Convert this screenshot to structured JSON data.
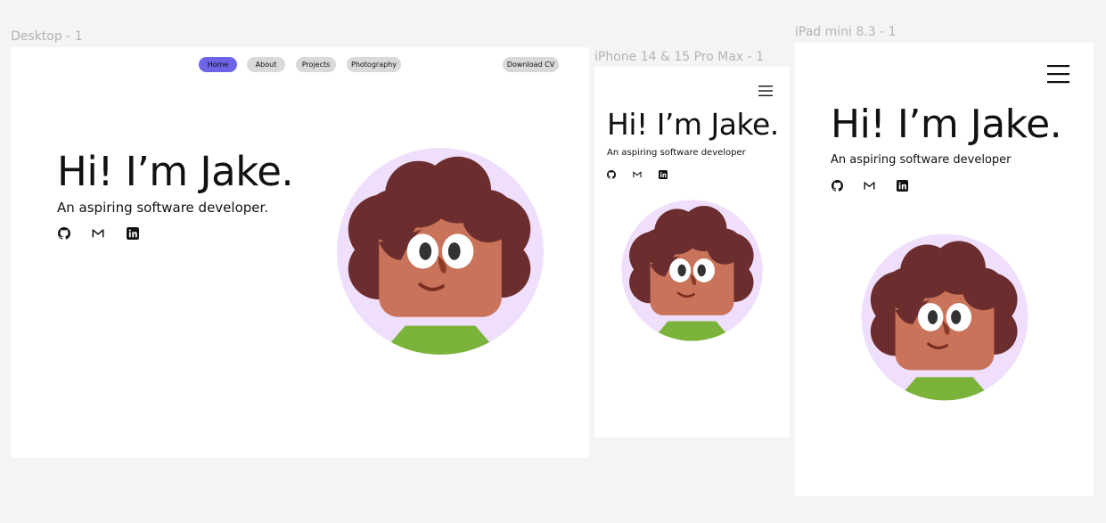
{
  "frames": {
    "desktop": {
      "label": "Desktop - 1",
      "nav": {
        "home": "Home",
        "about": "About",
        "projects": "Projects",
        "photography": "Photography",
        "download_cv": "Download CV"
      },
      "title": "Hi! I’m Jake.",
      "subtitle": "An aspiring software developer."
    },
    "iphone": {
      "label": "iPhone 14 & 15 Pro Max - 1",
      "title": "Hi! I’m Jake.",
      "subtitle": "An aspiring software developer"
    },
    "ipad": {
      "label": "iPad mini 8.3 - 1",
      "title": "Hi! I’m Jake.",
      "subtitle": "An aspiring software developer"
    }
  },
  "colors": {
    "canvas": "#f4f4f4",
    "nav_active": "#6c63e6",
    "nav_inactive": "#d9d9d9",
    "avatar_bg": "#efdefc",
    "hair": "#6b2d2d",
    "skin": "#c8735a",
    "shirt": "#7bb33a"
  },
  "icons": [
    "github-icon",
    "gmail-icon",
    "linkedin-icon",
    "menu-icon"
  ]
}
